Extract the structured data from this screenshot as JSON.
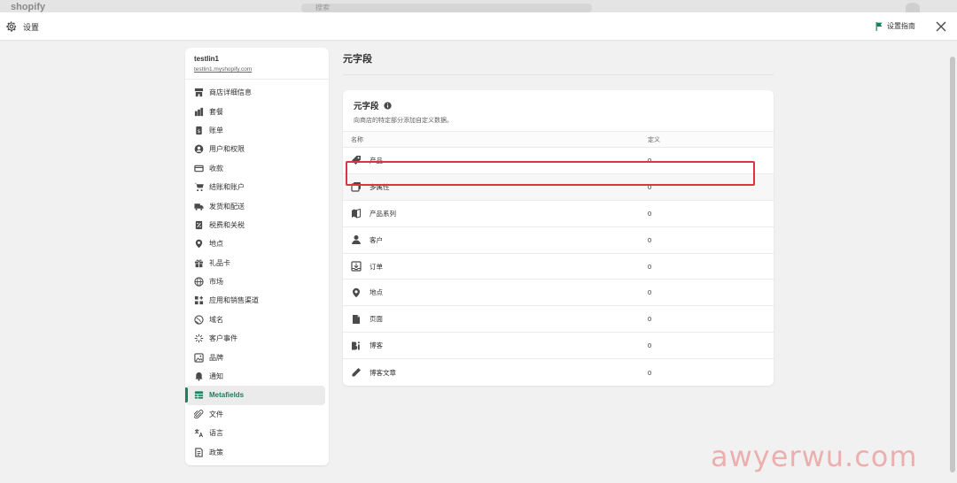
{
  "background": {
    "brand": "shopify",
    "search_placeholder": "搜索"
  },
  "topbar": {
    "title": "设置",
    "guide_label": "设置指南"
  },
  "store": {
    "name": "testlin1",
    "url": "testlin1.myshopify.com"
  },
  "sidebar": {
    "items": [
      {
        "label": "商店详细信息",
        "icon": "store-icon"
      },
      {
        "label": "套餐",
        "icon": "plan-icon"
      },
      {
        "label": "账单",
        "icon": "billing-icon"
      },
      {
        "label": "用户和权限",
        "icon": "user-circle-icon"
      },
      {
        "label": "收款",
        "icon": "payments-icon"
      },
      {
        "label": "结账和账户",
        "icon": "cart-icon"
      },
      {
        "label": "发货和配送",
        "icon": "truck-icon"
      },
      {
        "label": "税费和关税",
        "icon": "tax-icon"
      },
      {
        "label": "地点",
        "icon": "location-icon"
      },
      {
        "label": "礼品卡",
        "icon": "gift-icon"
      },
      {
        "label": "市场",
        "icon": "globe-icon"
      },
      {
        "label": "应用和销售渠道",
        "icon": "apps-icon"
      },
      {
        "label": "域名",
        "icon": "domain-icon"
      },
      {
        "label": "客户事件",
        "icon": "sparkle-icon"
      },
      {
        "label": "品牌",
        "icon": "brand-icon"
      },
      {
        "label": "通知",
        "icon": "bell-icon"
      },
      {
        "label": "Metafields",
        "icon": "metafields-icon",
        "active": true
      },
      {
        "label": "文件",
        "icon": "paperclip-icon"
      },
      {
        "label": "语言",
        "icon": "translate-icon"
      },
      {
        "label": "政策",
        "icon": "policy-icon"
      }
    ]
  },
  "main": {
    "page_title": "元字段",
    "card": {
      "title": "元字段",
      "subtitle": "向商店的特定部分添加自定义数据。",
      "col_name": "名称",
      "col_def": "定义",
      "rows": [
        {
          "label": "产品",
          "count": "0",
          "icon": "tag-icon"
        },
        {
          "label": "多属性",
          "count": "0",
          "icon": "variants-icon"
        },
        {
          "label": "产品系列",
          "count": "0",
          "icon": "collection-icon"
        },
        {
          "label": "客户",
          "count": "0",
          "icon": "person-icon"
        },
        {
          "label": "订单",
          "count": "0",
          "icon": "order-icon"
        },
        {
          "label": "地点",
          "count": "0",
          "icon": "location-icon"
        },
        {
          "label": "页面",
          "count": "0",
          "icon": "page-icon"
        },
        {
          "label": "博客",
          "count": "0",
          "icon": "blog-icon"
        },
        {
          "label": "博客文章",
          "count": "0",
          "icon": "pencil-icon"
        }
      ]
    }
  },
  "colors": {
    "accent": "#1a7f5a",
    "highlight": "#d9363e",
    "watermark": "#e77878"
  },
  "watermark": "awyerwu.com"
}
